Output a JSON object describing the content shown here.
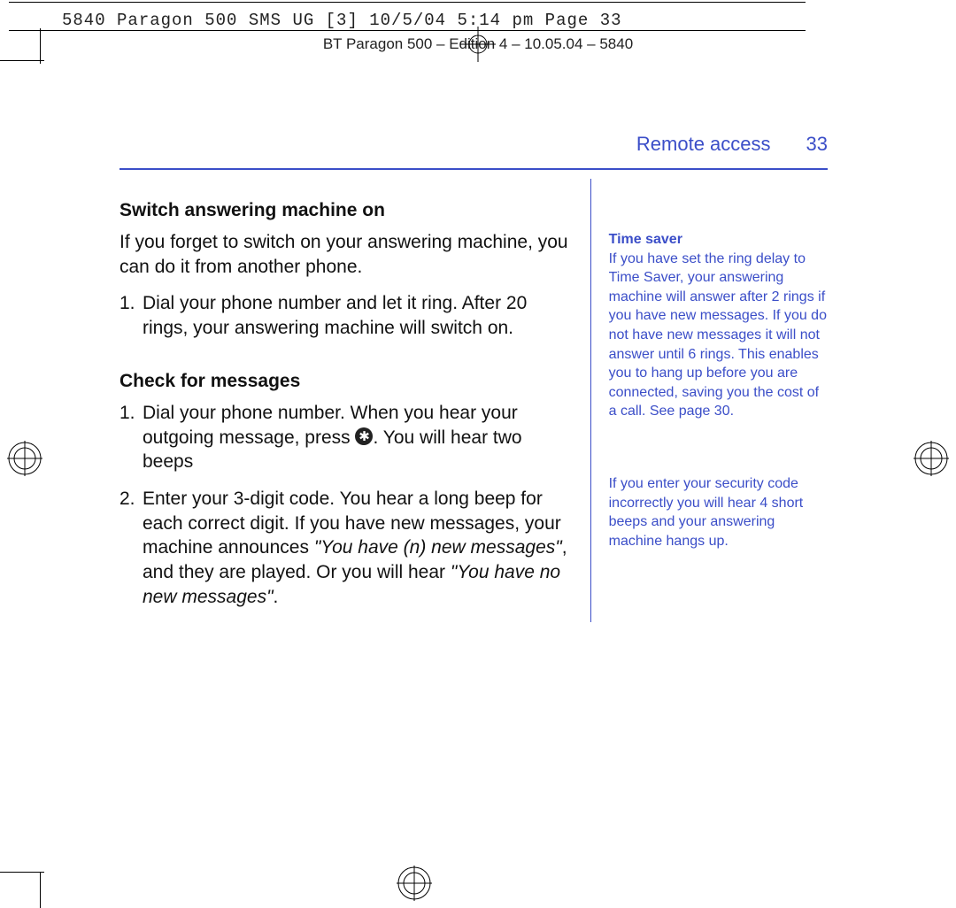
{
  "print_header": "5840 Paragon 500 SMS UG [3]  10/5/04  5:14 pm  Page 33",
  "running_header": "BT Paragon 500 – Edition 4 – 10.05.04 – 5840",
  "section_title": "Remote access",
  "page_number": "33",
  "main": {
    "h1": "Switch answering machine on",
    "p1": "If you forget to switch on your answering machine, you can do it from another phone.",
    "step1_n": "1.",
    "step1_t": "Dial your phone number and let it ring. After 20 rings, your answering machine will switch on.",
    "h2": "Check for messages",
    "step2_n": "1.",
    "step2_t_a": "Dial your phone number. When you hear your outgoing message, press ",
    "step2_t_b": ". You will hear two beeps",
    "step3_n": "2.",
    "step3_t_a": "Enter your 3-digit code. You hear a long beep for each correct digit. If you have new messages, your machine announces ",
    "step3_it1": "\"You have (n) new messages\"",
    "step3_t_b": ", and they are played. Or you will hear ",
    "step3_it2": "\"You have no new messages\"",
    "step3_t_c": "."
  },
  "sidebar": {
    "h1": "Time saver",
    "p1": "If you have set the ring delay to Time Saver, your answering machine will answer after 2 rings if you have new messages. If you do not have new messages it will not answer until 6 rings. This enables you to hang up before you are connected, saving you the cost of a call. See page 30.",
    "p2": "If you enter your security code incorrectly you will hear 4 short beeps and your answering machine hangs up."
  }
}
